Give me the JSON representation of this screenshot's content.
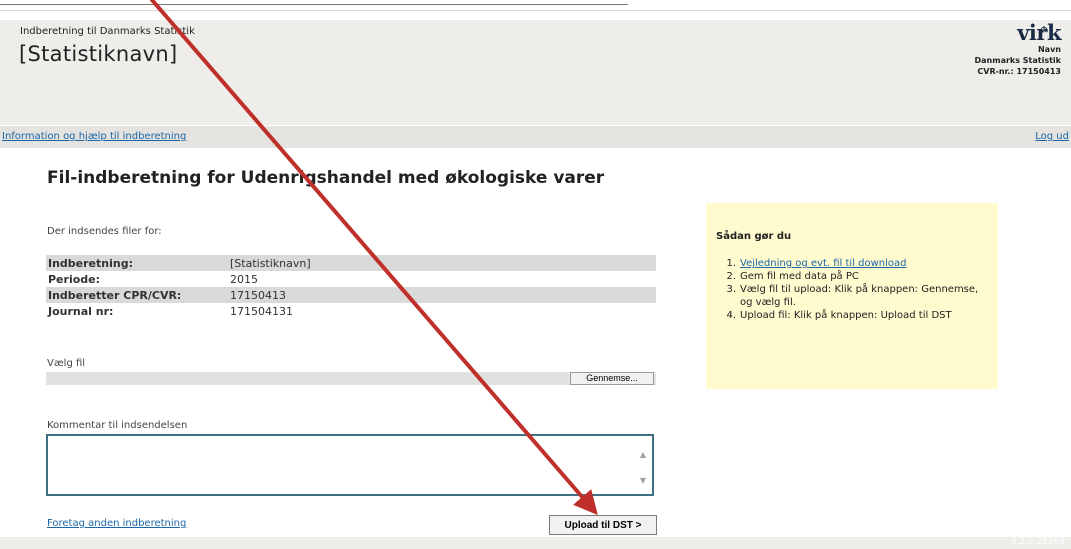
{
  "header": {
    "small_title": "Indberetning til Danmarks Statistik",
    "title": "[Statistiknavn]",
    "logo": "virk",
    "user_name": "Navn",
    "org": "Danmarks Statistik",
    "cvr": "CVR-nr.: 17150413"
  },
  "nav": {
    "info_link": "Information og hjælp til indberetning",
    "logout": "Log ud"
  },
  "main": {
    "title": "Fil-indberetning for Udenrigshandel med økologiske varer",
    "subtitle": "Der indsendes filer for:",
    "rows": [
      {
        "label": "Indberetning:",
        "value": "[Statistiknavn]"
      },
      {
        "label": "Periode:",
        "value": "2015"
      },
      {
        "label": "Indberetter CPR/CVR:",
        "value": "17150413"
      },
      {
        "label": "Journal nr:",
        "value": "171504131"
      }
    ],
    "file_label": "Vælg fil",
    "browse": "Gennemse...",
    "comment_label": "Kommentar til indsendelsen",
    "other_link": "Foretag anden indberetning",
    "upload": "Upload til DST >"
  },
  "help": {
    "title": "Sådan gør du",
    "steps": [
      {
        "num": "1.",
        "text": "Vejledning og evt. fil til download"
      },
      {
        "num": "2.",
        "text": "Gem fil med data på PC"
      },
      {
        "num": "3.",
        "text": "Vælg fil til upload: Klik på knappen: Gennemse, og vælg fil."
      },
      {
        "num": "4.",
        "text": "Upload fil: Klik på knappen: Upload til DST"
      }
    ]
  },
  "footer": {
    "version": "3.2.0.21163"
  },
  "colors": {
    "link": "#1a66a6",
    "help_bg": "#fffbcf",
    "arrow": "#c0302a",
    "header_bg": "#eeedea"
  }
}
